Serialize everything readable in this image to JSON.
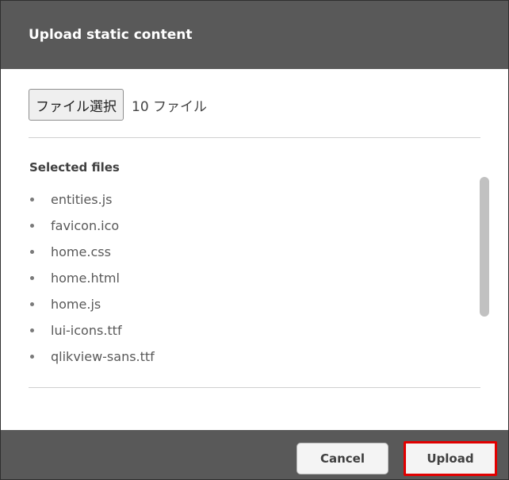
{
  "dialog": {
    "title": "Upload static content"
  },
  "file_picker": {
    "button_label": "ファイル選択",
    "count_label": "10 ファイル"
  },
  "selected_files": {
    "title": "Selected files",
    "items": [
      "entities.js",
      "favicon.ico",
      "home.css",
      "home.html",
      "home.js",
      "lui-icons.ttf",
      "qlikview-sans.ttf"
    ]
  },
  "footer": {
    "cancel_label": "Cancel",
    "upload_label": "Upload"
  },
  "colors": {
    "header_background": "#595959",
    "highlight_border": "#e10000"
  }
}
